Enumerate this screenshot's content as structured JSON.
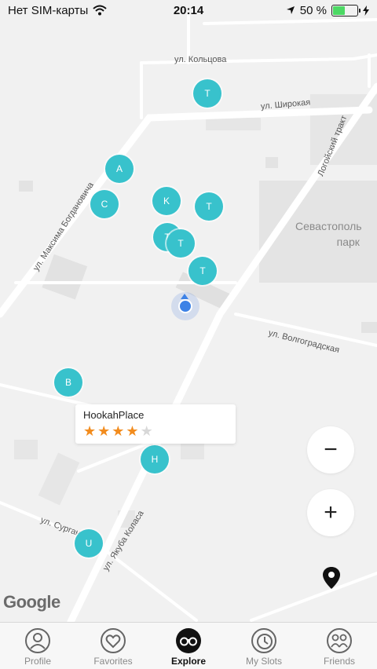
{
  "status_bar": {
    "carrier": "Нет SIM-карты",
    "time": "20:14",
    "battery_percent": "50 %",
    "battery_level": 0.5
  },
  "map": {
    "streets": [
      "ул. Кольцова",
      "ул. Широкая",
      "Логойский тракт",
      "ул. Максима Богдановича",
      "ул. Волгоградская",
      "ул. Сурганова",
      "ул. Якуба Коласа"
    ],
    "district_label": [
      "Севастополь",
      "парк"
    ],
    "markers": [
      "T",
      "A",
      "C",
      "K",
      "T",
      "T",
      "T",
      "T",
      "B",
      "H",
      "U"
    ],
    "popup": {
      "title": "HookahPlace",
      "rating": 4,
      "max_rating": 5
    },
    "zoom_out_label": "−",
    "zoom_in_label": "+",
    "attribution": "Google"
  },
  "tab_bar": {
    "items": [
      {
        "label": "Profile",
        "icon": "profile-icon",
        "active": false
      },
      {
        "label": "Favorites",
        "icon": "heart-icon",
        "active": false
      },
      {
        "label": "Explore",
        "icon": "binoculars-icon",
        "active": true
      },
      {
        "label": "My Slots",
        "icon": "clock-icon",
        "active": false
      },
      {
        "label": "Friends",
        "icon": "friends-icon",
        "active": false
      }
    ]
  }
}
